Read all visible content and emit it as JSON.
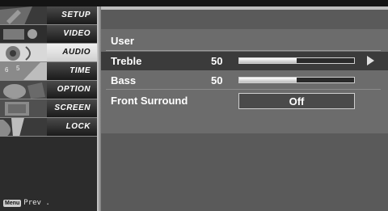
{
  "sidebar": {
    "items": [
      {
        "label": "SETUP",
        "icon": "setup-icon"
      },
      {
        "label": "VIDEO",
        "icon": "video-icon"
      },
      {
        "label": "AUDIO",
        "icon": "audio-icon"
      },
      {
        "label": "TIME",
        "icon": "time-icon"
      },
      {
        "label": "OPTION",
        "icon": "option-icon"
      },
      {
        "label": "SCREEN",
        "icon": "screen-icon"
      },
      {
        "label": "LOCK",
        "icon": "lock-icon"
      }
    ],
    "active_index": 2,
    "menu_key": "Menu",
    "prev_label": "Prev ."
  },
  "panel": {
    "title": "User",
    "rows": [
      {
        "label": "Treble",
        "value": "50",
        "level": 0.5,
        "selected": true
      },
      {
        "label": "Bass",
        "value": "50",
        "level": 0.5,
        "selected": false
      },
      {
        "label": "Front Surround",
        "option": "Off",
        "selected": false
      }
    ]
  },
  "colors": {
    "panel_bg": "#5a5a5a",
    "highlight_row": "#3b3b3b",
    "bar_fill": "#ffffff"
  }
}
